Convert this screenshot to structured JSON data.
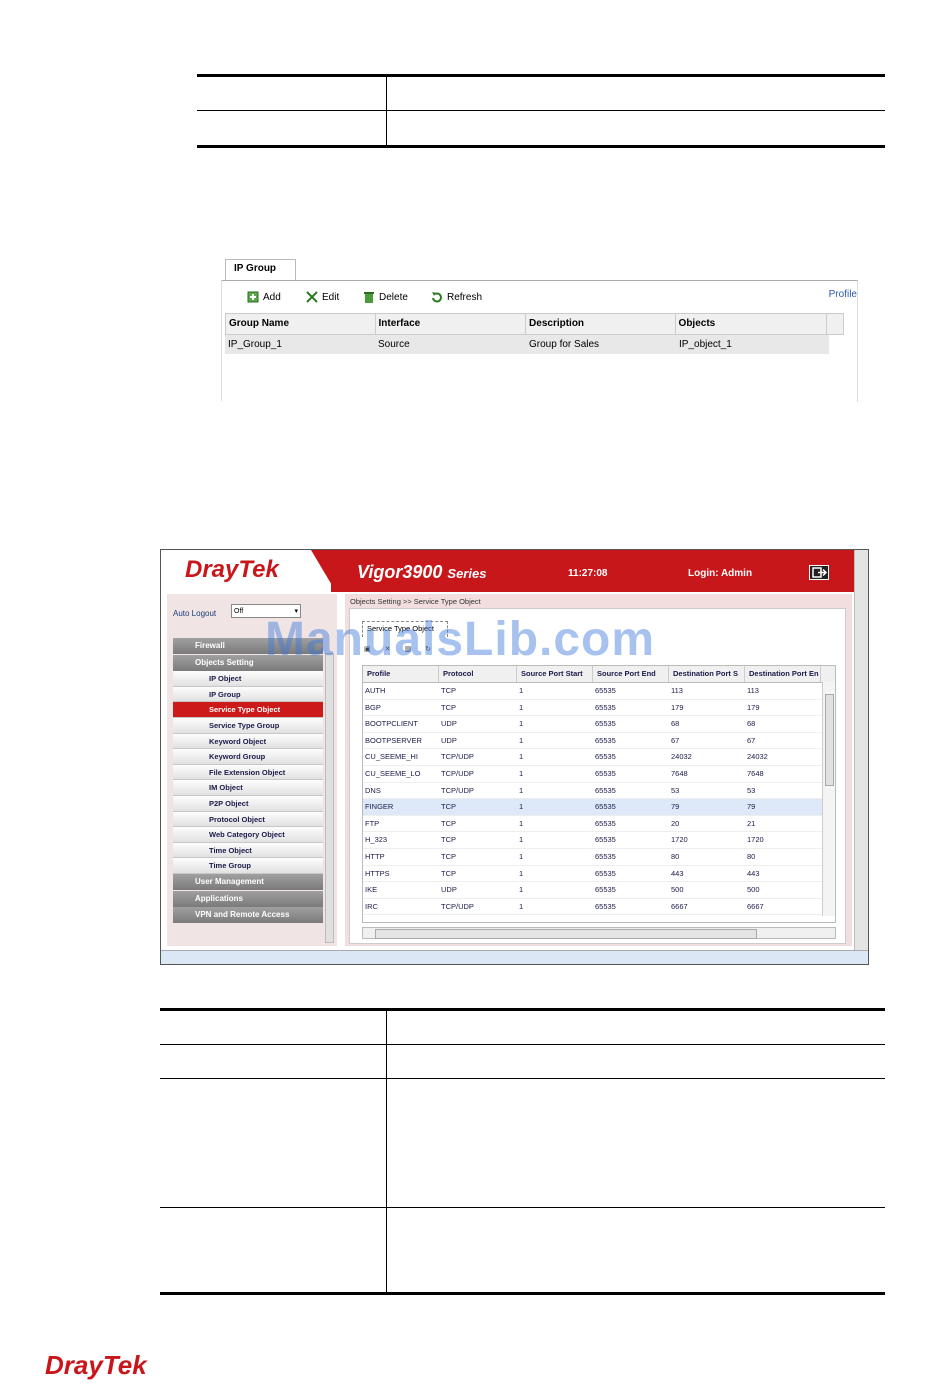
{
  "ip_group_panel": {
    "tab_label": "IP Group",
    "toolbar": {
      "add_label": "Add",
      "edit_label": "Edit",
      "delete_label": "Delete",
      "refresh_label": "Refresh"
    },
    "profile_link": "Profile",
    "columns": [
      "Group Name",
      "Interface",
      "Description",
      "Objects"
    ],
    "rows": [
      [
        "IP_Group_1",
        "Source",
        "Group for Sales",
        "IP_object_1"
      ]
    ]
  },
  "vigor_ui": {
    "brand": "DrayTek",
    "series_model": "Vigor3900",
    "series_suffix": "Series",
    "clock": "11:27:08",
    "login": "Login: Admin",
    "auto_logout_label": "Auto Logout",
    "auto_logout_value": "Off",
    "menu": [
      {
        "type": "cat",
        "label": "Firewall"
      },
      {
        "type": "cat",
        "label": "Objects Setting"
      },
      {
        "type": "item",
        "label": "IP Object"
      },
      {
        "type": "item",
        "label": "IP Group"
      },
      {
        "type": "item",
        "label": "Service Type Object",
        "active": true
      },
      {
        "type": "item",
        "label": "Service Type Group"
      },
      {
        "type": "item",
        "label": "Keyword Object"
      },
      {
        "type": "item",
        "label": "Keyword Group"
      },
      {
        "type": "item",
        "label": "File Extension Object"
      },
      {
        "type": "item",
        "label": "IM Object"
      },
      {
        "type": "item",
        "label": "P2P Object"
      },
      {
        "type": "item",
        "label": "Protocol Object"
      },
      {
        "type": "item",
        "label": "Web Category Object"
      },
      {
        "type": "item",
        "label": "Time Object"
      },
      {
        "type": "item",
        "label": "Time Group"
      },
      {
        "type": "cat",
        "label": "User Management"
      },
      {
        "type": "cat",
        "label": "Applications"
      },
      {
        "type": "cat",
        "label": "VPN and Remote Access"
      }
    ],
    "breadcrumb": "Objects Setting >> Service Type Object",
    "content_tab": "Service Type Object",
    "columns": [
      "Profile",
      "Protocol",
      "Source Port Start",
      "Source Port End",
      "Destination Port S",
      "Destination Port En"
    ],
    "rows": [
      [
        "AUTH",
        "TCP",
        "1",
        "65535",
        "113",
        "113"
      ],
      [
        "BGP",
        "TCP",
        "1",
        "65535",
        "179",
        "179"
      ],
      [
        "BOOTPCLIENT",
        "UDP",
        "1",
        "65535",
        "68",
        "68"
      ],
      [
        "BOOTPSERVER",
        "UDP",
        "1",
        "65535",
        "67",
        "67"
      ],
      [
        "CU_SEEME_HI",
        "TCP/UDP",
        "1",
        "65535",
        "24032",
        "24032"
      ],
      [
        "CU_SEEME_LO",
        "TCP/UDP",
        "1",
        "65535",
        "7648",
        "7648"
      ],
      [
        "DNS",
        "TCP/UDP",
        "1",
        "65535",
        "53",
        "53"
      ],
      [
        "FINGER",
        "TCP",
        "1",
        "65535",
        "79",
        "79"
      ],
      [
        "FTP",
        "TCP",
        "1",
        "65535",
        "20",
        "21"
      ],
      [
        "H_323",
        "TCP",
        "1",
        "65535",
        "1720",
        "1720"
      ],
      [
        "HTTP",
        "TCP",
        "1",
        "65535",
        "80",
        "80"
      ],
      [
        "HTTPS",
        "TCP",
        "1",
        "65535",
        "443",
        "443"
      ],
      [
        "IKE",
        "UDP",
        "1",
        "65535",
        "500",
        "500"
      ],
      [
        "IRC",
        "TCP/UDP",
        "1",
        "65535",
        "6667",
        "6667"
      ]
    ],
    "highlighted_row": "FINGER"
  },
  "watermark": "ManualsLib.com",
  "footer_logo": "DrayTek"
}
